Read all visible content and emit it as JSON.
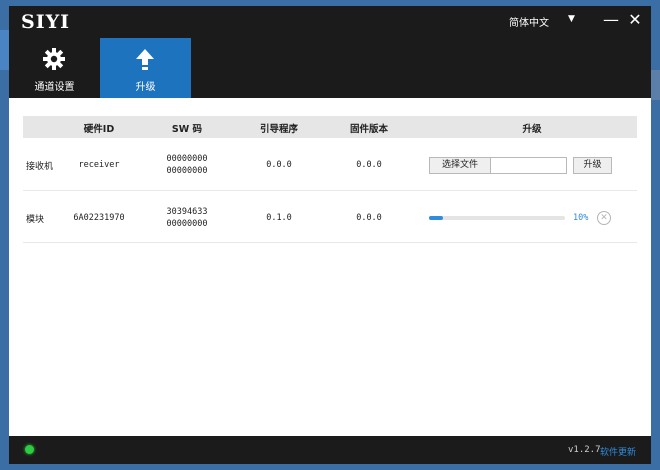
{
  "app": {
    "logo_text": "SIYI",
    "language": "简体中文",
    "minimize_glyph": "—",
    "close_glyph": "✕"
  },
  "nav": {
    "tabs": [
      {
        "label": "通道设置",
        "icon": "gear-icon",
        "active": false
      },
      {
        "label": "升级",
        "icon": "upload-arrow-icon",
        "active": true
      }
    ]
  },
  "table": {
    "headers": [
      "硬件ID",
      "SW 码",
      "引导程序",
      "固件版本",
      "升级"
    ],
    "rows": [
      {
        "name": "接收机",
        "hardware_id": "receiver",
        "sw_code_1": "00000000",
        "sw_code_2": "00000000",
        "bootloader": "0.0.0",
        "firmware": "0.0.0",
        "choose_file_label": "选择文件",
        "file_path": "",
        "upgrade_label": "升级"
      },
      {
        "name": "模块",
        "hardware_id": "6A02231970",
        "sw_code_1": "30394633",
        "sw_code_2": "00000000",
        "bootloader": "0.1.0",
        "firmware": "0.0.0",
        "progress_percent": 10,
        "progress_label": "10%",
        "cancel_glyph": "✕"
      }
    ]
  },
  "status": {
    "connected_color": "#2ecc40",
    "version": "v1.2.7",
    "update_link": "软件更新"
  },
  "colors": {
    "accent": "#1e73be",
    "progress": "#2f8bdc",
    "chrome": "#1b1b1b"
  }
}
